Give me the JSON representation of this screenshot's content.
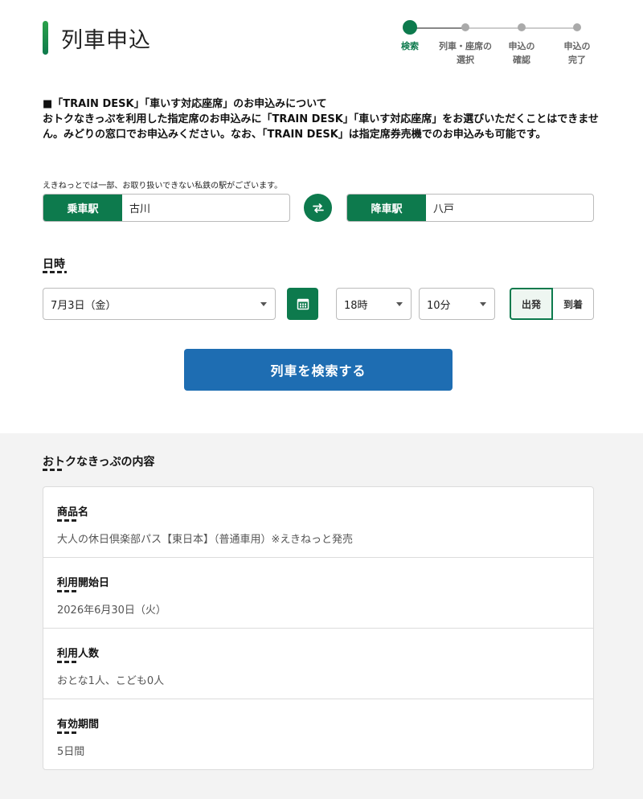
{
  "page": {
    "title": "列車申込"
  },
  "stepper": {
    "steps": [
      {
        "label_line1": "検索",
        "label_line2": ""
      },
      {
        "label_line1": "列車・座席の",
        "label_line2": "選択"
      },
      {
        "label_line1": "申込の",
        "label_line2": "確認"
      },
      {
        "label_line1": "申込の",
        "label_line2": "完了"
      }
    ],
    "active_index": 0
  },
  "notice": {
    "heading": "■「TRAIN DESK」「車いす対応座席」のお申込みについて",
    "body": "おトクなきっぷを利用した指定席のお申込みに「TRAIN DESK」「車いす対応座席」をお選びいただくことはできません。みどりの窓口でお申込みください。なお、「TRAIN DESK」は指定席券売機でのお申込みも可能です。"
  },
  "search": {
    "private_rail_note": "えきねっとでは一部、お取り扱いできない私鉄の駅がございます。",
    "departure_label": "乗車駅",
    "departure_value": "古川",
    "arrival_label": "降車駅",
    "arrival_value": "八戸",
    "swap_icon": "swap-arrows-icon",
    "date_section_label": "日時",
    "date_value": "7月3日（金）",
    "calendar_icon": "calendar-icon",
    "hour_value": "18時",
    "minute_value": "10分",
    "depart_option": "出発",
    "arrive_option": "到着",
    "selected_option": "出発",
    "submit_label": "列車を検索する"
  },
  "ticket": {
    "section_title": "おトクなきっぷの内容",
    "rows": [
      {
        "label": "商品名",
        "value": "大人の休日倶楽部パス【東日本】（普通車用）※えきねっと発売"
      },
      {
        "label": "利用開始日",
        "value": "2026年6月30日（火）"
      },
      {
        "label": "利用人数",
        "value": "おとな1人、こども0人"
      },
      {
        "label": "有効期間",
        "value": "5日間"
      }
    ]
  },
  "colors": {
    "brand_green": "#0d7a4d",
    "search_blue": "#1e6db2",
    "gray_bg": "#f3f3f3"
  }
}
